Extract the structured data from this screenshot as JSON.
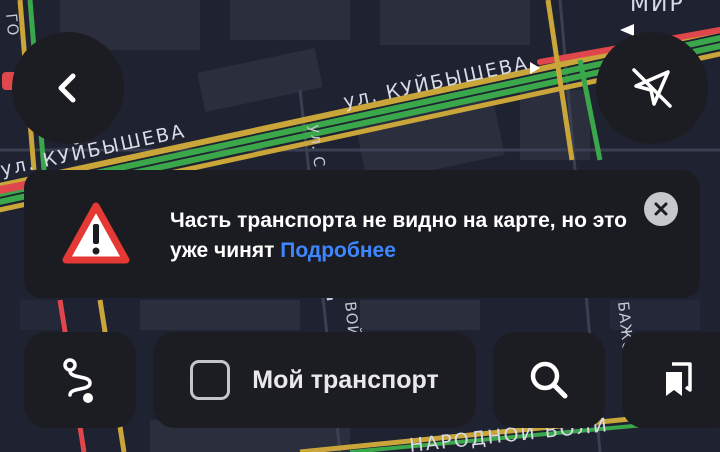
{
  "map": {
    "street_kuybysheva_top": "ул. КУЙБЫШЕВА",
    "street_kuybysheva_left": "ул. КУЙБЫШЕВА",
    "street_vertical_small": "ул. С",
    "street_bottom": "НАРОДНОЙ ВОЛИ",
    "street_side_left": "ВОЙ",
    "street_side_right": "БАЖОВА",
    "label_top_right": "МИР",
    "label_top_left": "ГО"
  },
  "banner": {
    "message": "Часть транспорта не видно на карте, но это уже чинят",
    "link": "Подробнее"
  },
  "bottom_bar": {
    "my_transport_label": "Мой транспорт"
  },
  "icons": {
    "back": "chevron-left-icon",
    "no_tracking": "location-off-icon",
    "warning": "warning-triangle-icon",
    "close": "close-icon",
    "route": "route-icon",
    "search": "search-icon",
    "bookmarks": "bookmarks-icon"
  },
  "colors": {
    "traffic_green": "#3aa84a",
    "traffic_yellow": "#c9a53a",
    "traffic_red": "#e0474c",
    "link_blue": "#3d86ff",
    "warning_red": "#e53935"
  }
}
